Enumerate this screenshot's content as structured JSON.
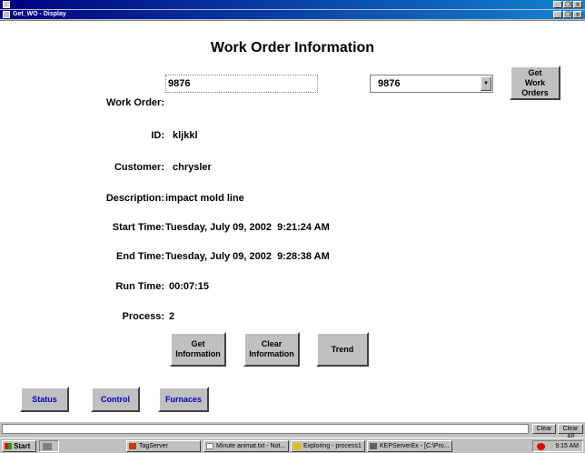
{
  "window": {
    "inner_title": "Get_WO - Display"
  },
  "page": {
    "title": "Work Order Information"
  },
  "form": {
    "work_order_label": "Work Order:",
    "work_order_value": "9876",
    "id_label": "ID:",
    "id_value": "kljkkl",
    "customer_label": "Customer:",
    "customer_value": "chrysler",
    "description_label": "Description:",
    "description_value": "impact mold line",
    "start_time_label": "Start Time:",
    "start_time_value": "Tuesday, July 09, 2002  9:21:24 AM",
    "end_time_label": "End Time:",
    "end_time_value": "Tuesday, July 09, 2002  9:28:38 AM",
    "run_time_label": "Run Time:",
    "run_time_value": "00:07:15",
    "process_label": "Process:",
    "process_value": "2"
  },
  "combo": {
    "selected": "9876"
  },
  "buttons": {
    "get_work_orders_1": "Get",
    "get_work_orders_2": "Work Orders",
    "get_info_1": "Get",
    "get_info_2": "Information",
    "clear_info_1": "Clear",
    "clear_info_2": "Information",
    "trend": "Trend"
  },
  "nav": {
    "status": "Status",
    "control": "Control",
    "furnaces": "Furnaces"
  },
  "bottom": {
    "clear": "Clear",
    "clear_all": "Clear All"
  },
  "taskbar": {
    "start": "Start",
    "tasks": [
      "TagServer",
      "Minute animat.txt - Not...",
      "Exploring - process1",
      "KEPServerEx - [C:\\Pro..."
    ],
    "clock": "9:15 AM"
  },
  "colors": {
    "titlebar": "#000080",
    "nav_text": "#0000c0",
    "face": "#c0c0c0"
  }
}
